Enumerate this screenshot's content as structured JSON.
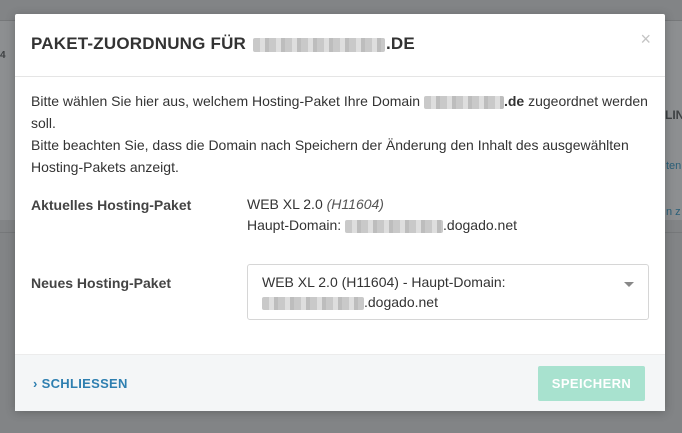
{
  "background": {
    "fragment_left": "4",
    "fragment_right_1": "LIN",
    "fragment_right_2": "ten",
    "fragment_right_3": "n z"
  },
  "modal": {
    "title_prefix": "PAKET-ZUORDNUNG FÜR",
    "title_suffix": ".DE",
    "close_symbol": "×",
    "intro_part1": "Bitte wählen Sie hier aus, welchem Hosting-Paket Ihre Domain",
    "intro_domain_suffix": ".de",
    "intro_part2": "zugeordnet werden soll.",
    "intro_line2": "Bitte beachten Sie, dass die Domain nach Speichern der Änderung den Inhalt des ausgewählten Hosting-Pakets anzeigt.",
    "current_label": "Aktuelles Hosting-Paket",
    "current_name": "WEB XL 2.0",
    "current_code": "(H11604)",
    "main_domain_label": "Haupt-Domain:",
    "main_domain_suffix": ".dogado.net",
    "new_label": "Neues Hosting-Paket",
    "select_value_line1": "WEB XL 2.0 (H11604) - Haupt-Domain:",
    "select_value_suffix": ".dogado.net",
    "close_link_chevron": "›",
    "close_link_label": "SCHLIESSEN",
    "save_label": "SPEICHERN"
  },
  "colors": {
    "accent_link": "#2e7fb0",
    "save_button_disabled": "#a8e2cf",
    "overlay": "#7d7f81"
  }
}
